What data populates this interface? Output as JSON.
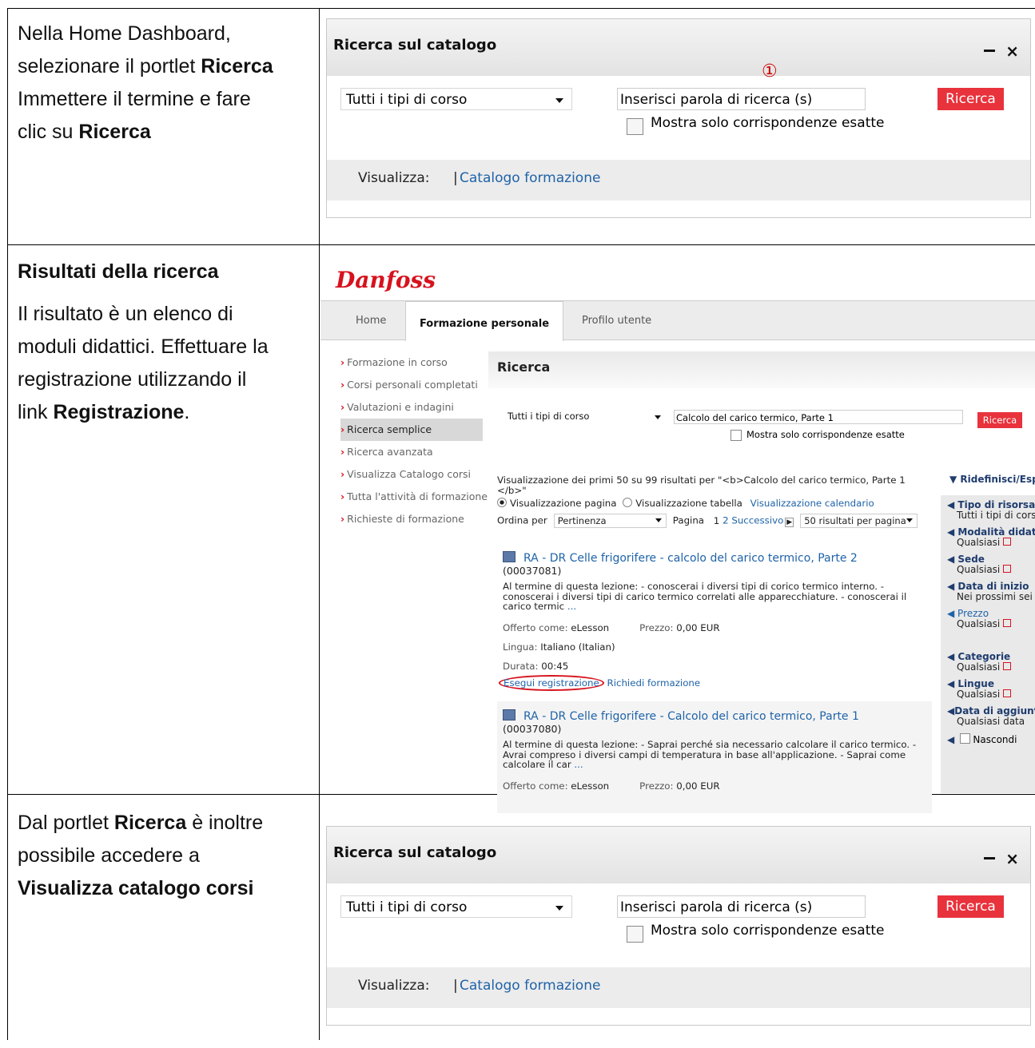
{
  "rows": [
    {
      "lines": [
        [
          "Nella Home Dashboard,"
        ],
        [
          "selezionare il portlet ",
          "Ricerca"
        ],
        [
          "Immettere il termine e fare"
        ],
        [
          "clic su ",
          "Ricerca"
        ]
      ]
    },
    {
      "title": "Risultati della ricerca",
      "lines": [
        [
          "Il risultato è un elenco di"
        ],
        [
          "moduli didattici. Effettuare la"
        ],
        [
          "registrazione utilizzando il"
        ],
        [
          "link ",
          "Registrazione",
          "."
        ]
      ]
    },
    {
      "lines": [
        [
          "Dal portlet ",
          "Ricerca",
          " è inoltre"
        ],
        [
          "possibile accedere a"
        ],
        [
          "",
          "Visualizza catalogo corsi"
        ]
      ]
    }
  ],
  "portlet": {
    "title": "Ricerca sul catalogo",
    "select_value": "Tutti i tipi di corso",
    "search_value": "Inserisci parola di ricerca (s)",
    "button": "Ricerca",
    "exact_label": "Mostra solo corrispondenze esatte",
    "view_label": "Visualizza:",
    "view_sep": "|",
    "view_link": "Catalogo formazione",
    "step_marker": "①"
  },
  "lms": {
    "logo": "Danfoss",
    "tabs": [
      "Home",
      "Formazione personale",
      "Profilo utente"
    ],
    "nav": [
      "Formazione in corso",
      "Corsi personali completati",
      "Valutazioni e indagini",
      "Ricerca semplice",
      "Ricerca avanzata",
      "Visualizza Catalogo corsi",
      "Tutta l'attività di formazione",
      "Richieste di formazione"
    ],
    "heading": "Ricerca",
    "select_value": "Tutti i tipi di corso",
    "search_value": "Calcolo del carico termico, Parte 1",
    "button": "Ricerca",
    "exact_label": "Mostra solo corrispondenze esatte",
    "result_summary": "Visualizzazione dei primi 50 su 99 risultati  per \"<b>Calcolo del carico termico, Parte 1 </b>\"",
    "view_page": "Visualizzazione pagina",
    "view_table": "Visualizzazione tabella",
    "view_calendar": "Visualizzazione calendario",
    "sort_label": "Ordina per",
    "sort_value": "Pertinenza",
    "page_label": "Pagina",
    "page_current": "1",
    "page_next_num": "2",
    "page_next": "Successivo",
    "per_page": "50 risultati per pagina",
    "refine": "Ridefinisci/Espandi",
    "filters": [
      {
        "name": "Tipo di risorsa",
        "value": "Tutti i tipi di corso"
      },
      {
        "name": "Modalità didattica",
        "value": "Qualsiasi"
      },
      {
        "name": "Sede",
        "value": "Qualsiasi"
      },
      {
        "name": "Data di inizio",
        "value": "Nei prossimi sei mesi"
      },
      {
        "name": "Prezzo",
        "value": "Qualsiasi"
      },
      {
        "name": "Categorie",
        "value": "Qualsiasi"
      },
      {
        "name": "Lingue",
        "value": "Qualsiasi"
      },
      {
        "name": "Data di aggiunta",
        "value": "Qualsiasi data"
      },
      {
        "name": "",
        "value": "Nascondi"
      }
    ],
    "results": [
      {
        "title": "RA - DR Celle frigorifere - calcolo del carico termico, Parte 2",
        "code": "(00037081)",
        "description": "Al termine di questa lezione: - conoscerai i diversi tipi di corico termico interno. - conoscerai i diversi tipi di carico termico correlati alle apparecchiature. - conoscerai il carico termic",
        "more": "...",
        "offered_label": "Offerto come:",
        "offered": "eLesson",
        "price_label": "Prezzo:",
        "price": "0,00 EUR",
        "lang_label": "Lingua:",
        "lang": "Italiano (Italian)",
        "dur_label": "Durata:",
        "duration": "00:45",
        "register": "Esegui registrazione",
        "request": "Richiedi formazione"
      },
      {
        "title": "RA - DR Celle frigorifere - Calcolo del carico termico, Parte 1",
        "code": "(00037080)",
        "description": "Al termine di questa lezione: - Saprai perché sia necessario calcolare il carico termico. - Avrai compreso i diversi campi di temperatura in base all'applicazione. - Saprai come calcolare il car",
        "more": "...",
        "offered_label": "Offerto come:",
        "offered": "eLesson",
        "price_label": "Prezzo:",
        "price": "0,00 EUR"
      }
    ]
  }
}
